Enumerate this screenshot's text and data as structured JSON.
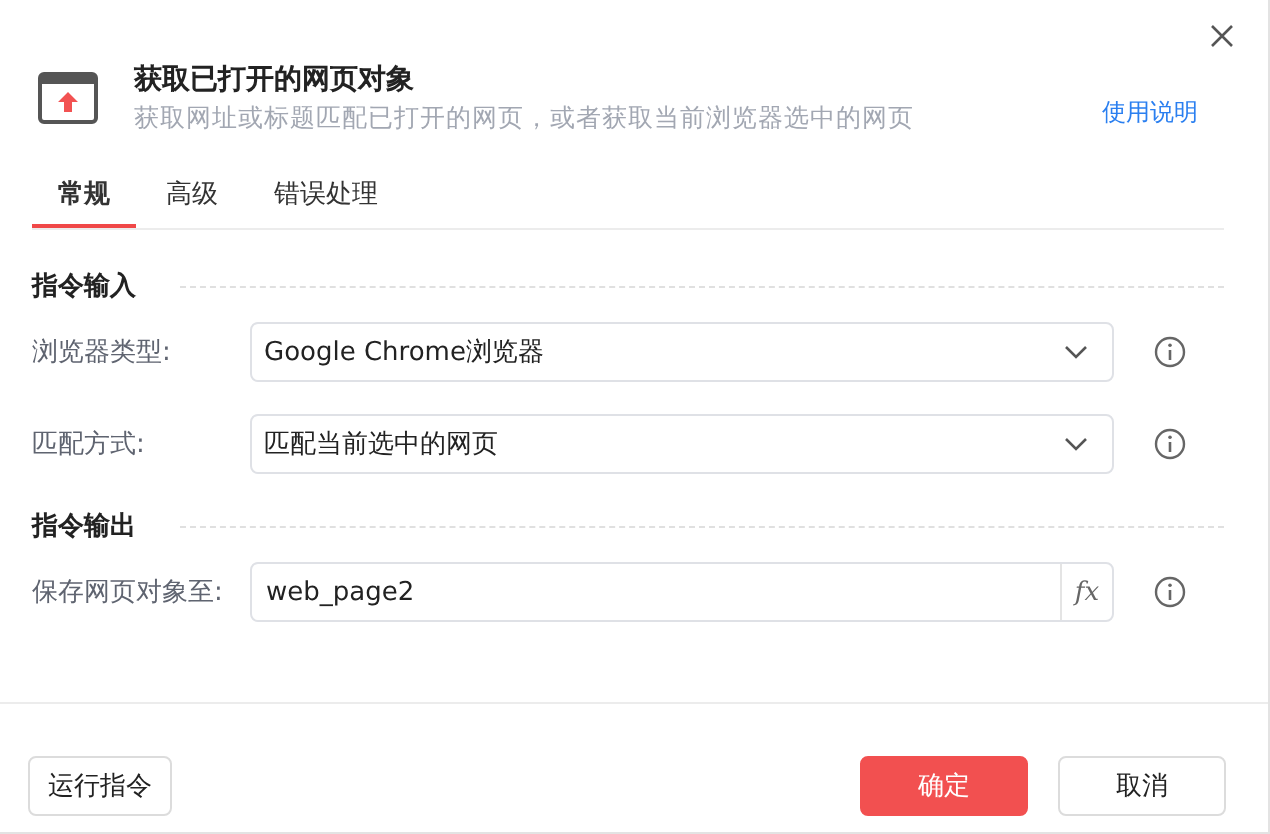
{
  "dialog": {
    "title": "获取已打开的网页对象",
    "description": "获取网址或标题匹配已打开的网页，或者获取当前浏览器选中的网页",
    "help_link": "使用说明"
  },
  "tabs": [
    {
      "label": "常规",
      "selected": true
    },
    {
      "label": "高级",
      "selected": false
    },
    {
      "label": "错误处理",
      "selected": false
    }
  ],
  "sections": [
    {
      "heading": "指令输入",
      "fields": [
        {
          "kind": "select",
          "label": "浏览器类型:",
          "value": "Google Chrome浏览器"
        },
        {
          "kind": "select",
          "label": "匹配方式:",
          "value": "匹配当前选中的网页"
        }
      ]
    },
    {
      "heading": "指令输出",
      "fields": [
        {
          "kind": "variable",
          "label": "保存网页对象至:",
          "value": "web_page2",
          "button": "fx"
        }
      ]
    }
  ],
  "footer": {
    "run_button": "运行指令",
    "confirm_button": "确定",
    "cancel_button": "取消"
  }
}
